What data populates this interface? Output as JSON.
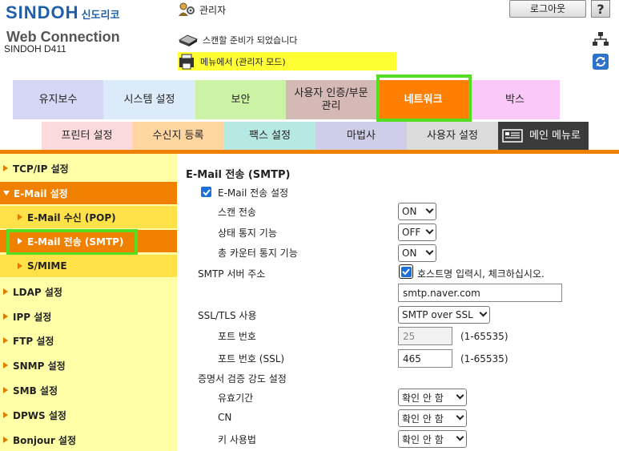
{
  "header": {
    "brand": "SINDOH",
    "brand_kr": "신도리코",
    "product": "Web Connection",
    "model": "SINDOH D411",
    "user": "관리자",
    "logout_label": "로그아웃",
    "help_label": "?",
    "status_text": "스캔할 준비가 되었습니다",
    "mode_text": "메뉴에서 (관리자 모드)"
  },
  "main_tabs": [
    {
      "label": "유지보수",
      "color": "#d6d6f7"
    },
    {
      "label": "시스템 설정",
      "color": "#dcebfa"
    },
    {
      "label": "보안",
      "color": "#ccf3a5"
    },
    {
      "label": "사용자 인증/부문 관리",
      "color": "#d5b9b4"
    },
    {
      "label": "네트워크",
      "color": "#ff7f00",
      "active": true
    },
    {
      "label": "박스",
      "color": "#fac9f9"
    }
  ],
  "sub_tabs": [
    {
      "label": "프린터 설정",
      "color": "#fcdadb"
    },
    {
      "label": "수신지 등록",
      "color": "#ffd5a0"
    },
    {
      "label": "팩스 설정",
      "color": "#b6e9e2"
    },
    {
      "label": "마법사",
      "color": "#cfcde7"
    },
    {
      "label": "사용자 설정",
      "color": "#dbdbdb"
    },
    {
      "label": "메인 메뉴로",
      "color": "#3b3b3b"
    }
  ],
  "sidebar": {
    "items": [
      {
        "label": "TCP/IP 설정"
      },
      {
        "label": "E-Mail 설정"
      },
      {
        "label": "E-Mail 수신 (POP)"
      },
      {
        "label": "E-Mail 전송 (SMTP)"
      },
      {
        "label": "S/MIME"
      },
      {
        "label": "LDAP 설정"
      },
      {
        "label": "IPP 설정"
      },
      {
        "label": "FTP 설정"
      },
      {
        "label": "SNMP 설정"
      },
      {
        "label": "SMB 설정"
      },
      {
        "label": "DPWS 설정"
      },
      {
        "label": "Bonjour 설정"
      }
    ]
  },
  "form": {
    "title": "E-Mail 전송 (SMTP)",
    "email_send_setting": "E-Mail 전송 설정",
    "scan_send_label": "스캔 전송",
    "scan_send_value": "ON",
    "status_notify_label": "상태 통지 기능",
    "status_notify_value": "OFF",
    "counter_notify_label": "총 카운터 통지 기능",
    "counter_notify_value": "ON",
    "smtp_server_label": "SMTP 서버 주소",
    "hostname_check_label": "호스트명 입력시, 체크하십시오.",
    "smtp_server_value": "smtp.naver.com",
    "ssl_label": "SSL/TLS 사용",
    "ssl_value": "SMTP over SSL",
    "port_label": "포트 번호",
    "port_value": "25",
    "port_range": "(1-65535)",
    "port_ssl_label": "포트 번호 (SSL)",
    "port_ssl_value": "465",
    "port_ssl_range": "(1-65535)",
    "cert_label": "증명서 검증 강도 설정",
    "validity_label": "유효기간",
    "validity_value": "확인 안 함",
    "cn_label": "CN",
    "cn_value": "확인 안 함",
    "key_usage_label": "키 사용법",
    "key_usage_value": "확인 안 함"
  },
  "colors": {
    "accent_orange": "#f08000",
    "sidebar_bg": "#ffffa8",
    "highlight_green": "#55dd22",
    "checkbox_blue": "#1a6fd9"
  }
}
